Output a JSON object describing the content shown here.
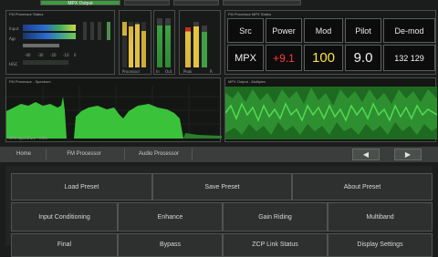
{
  "top_tabs": [
    {
      "label": "MPX Output",
      "active": true
    },
    {
      "label": "",
      "active": false
    },
    {
      "label": "",
      "active": false
    },
    {
      "label": "",
      "active": false
    }
  ],
  "fm_panel": {
    "title": "FM Processor Status",
    "rows": [
      "Input",
      "Agc",
      "",
      "HiSC"
    ],
    "scale": [
      "-40",
      "-30",
      "-20",
      "-10",
      "0"
    ],
    "meter_labels": [
      "Processor",
      "",
      "In",
      "Out",
      "Peak",
      "R"
    ]
  },
  "mpx_status": {
    "title": "FM Processor MPX Status",
    "headers": [
      "Src",
      "Power",
      "Mod",
      "Pilot",
      "De-mod"
    ],
    "values": [
      "MPX",
      "+9.1",
      "100",
      "9.0",
      "132 129"
    ]
  },
  "spectrum_left": {
    "title": "FM Processor - Spectrum",
    "footer": "MPX Spectrum - MPX"
  },
  "spectrum_right": {
    "title": "MPX Output - Multiplex"
  },
  "nav": {
    "items": [
      "Home",
      "FM Processor",
      "Audio Processor"
    ],
    "prev_icon": "◀",
    "next_icon": "▶"
  },
  "grid": {
    "row1": [
      "Load Preset",
      "Save Preset",
      "About Preset"
    ],
    "row2": [
      "Input Conditioning",
      "Enhance",
      "Gain Riding",
      "Multiband"
    ],
    "row3": [
      "Final",
      "Bypass",
      "ZCP Link Status",
      "Display Settings"
    ]
  },
  "colors": {
    "accent_green": "#3f9a3f",
    "spectrum_green": "#39c23a",
    "value_orange": "#ffe14a",
    "value_red": "#ff3a3a"
  }
}
